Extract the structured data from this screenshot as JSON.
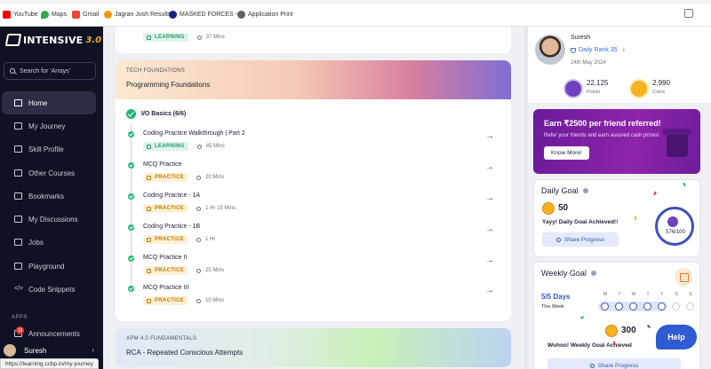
{
  "bookmarks": [
    {
      "label": "YouTube",
      "color": "#ff0000"
    },
    {
      "label": "Maps",
      "color": "#34a853"
    },
    {
      "label": "Gmail",
      "color": "#ea4335"
    },
    {
      "label": "Jagran Josh Results",
      "color": "#f29900"
    },
    {
      "label": "MASKED FORCES -...",
      "color": "#1a237e"
    },
    {
      "label": "Application Print",
      "color": "#5f6368"
    }
  ],
  "sidebar": {
    "logo": {
      "name": "INTENSIVE",
      "version": "3.0"
    },
    "search_placeholder": "Search for 'Arrays'",
    "items": [
      {
        "label": "Home",
        "active": true
      },
      {
        "label": "My Journey"
      },
      {
        "label": "Skill Profile"
      },
      {
        "label": "Other Courses"
      },
      {
        "label": "Bookmarks"
      },
      {
        "label": "My Discussions"
      },
      {
        "label": "Jobs"
      },
      {
        "label": "Playground"
      },
      {
        "label": "Code Snippets"
      }
    ],
    "apps_label": "APPS",
    "announcements": {
      "label": "Announcements",
      "badge": "19"
    },
    "user": "Suresh",
    "status_url": "https://learning.ccbp.in/my-journey"
  },
  "main": {
    "top_card": {
      "tag": "LEARNING",
      "duration": "37 Mins"
    },
    "section1": {
      "kicker": "TECH FOUNDATIONS",
      "title": "Programming Foundations",
      "group": "I/O Basics (6/6)",
      "lessons": [
        {
          "title": "Coding Practice Walkthrough | Part 2",
          "tag": "LEARNING",
          "duration": "45 Mins"
        },
        {
          "title": "MCQ Practice",
          "tag": "PRACTICE",
          "duration": "20 Mins"
        },
        {
          "title": "Coding Practice - 1A",
          "tag": "PRACTICE",
          "duration": "1 Hr 15 Mins"
        },
        {
          "title": "Coding Practice - 1B",
          "tag": "PRACTICE",
          "duration": "1 Hr"
        },
        {
          "title": "MCQ Practice II",
          "tag": "PRACTICE",
          "duration": "25 Mins"
        },
        {
          "title": "MCQ Practice III",
          "tag": "PRACTICE",
          "duration": "10 Mins"
        }
      ]
    },
    "section2": {
      "kicker": "XPM 4.0 FUNDAMENTALS",
      "title": "RCA - Repeated Conscious Attempts"
    }
  },
  "profile": {
    "name": "Suresh",
    "rank": "Daily Rank 35",
    "date": "24th May 2024",
    "points": "22,125",
    "points_label": "Points",
    "coins": "2,990",
    "coins_label": "Coins"
  },
  "promo": {
    "title": "Earn ₹2500 per friend referred!",
    "subtitle": "Refer your friends and earn assured cash prizes!",
    "button": "Know More!"
  },
  "daily_goal": {
    "title": "Daily Goal",
    "coins": "50",
    "message": "Yayy! Daily Goal Achieved!!",
    "share": "Share Progress",
    "progress": "576/100"
  },
  "weekly_goal": {
    "title": "Weekly Goal",
    "days": "5/5 Days",
    "this_week": "This Week",
    "day_letters": [
      "M",
      "T",
      "W",
      "T",
      "F",
      "S",
      "S"
    ],
    "completed_days": 5,
    "coins": "300",
    "message": "Wohoo! Weekly Goal Achieved",
    "share": "Share Progress"
  },
  "help": "Help"
}
